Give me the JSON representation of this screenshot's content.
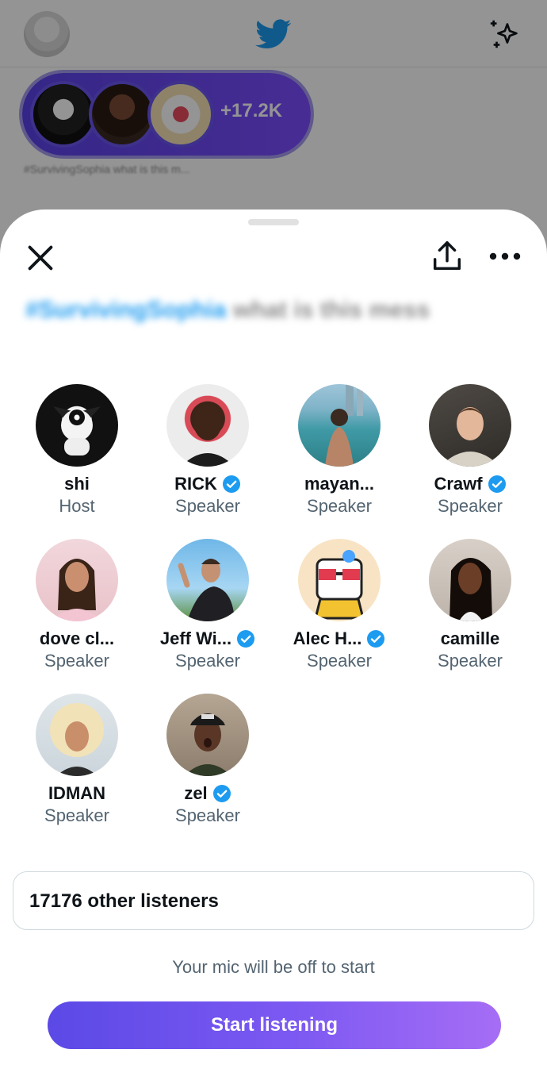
{
  "background": {
    "space_listener_count": "+17.2K",
    "space_snippet": "#SurvivingSophia what is this m..."
  },
  "sheet": {
    "title_hashtag": "#SurvivingSophia",
    "title_rest": "what is this mess"
  },
  "participants": [
    {
      "name": "shi",
      "role": "Host",
      "verified": false
    },
    {
      "name": "RICK",
      "role": "Speaker",
      "verified": true
    },
    {
      "name": "mayan...",
      "role": "Speaker",
      "verified": false
    },
    {
      "name": "Crawf",
      "role": "Speaker",
      "verified": true
    },
    {
      "name": "dove cl...",
      "role": "Speaker",
      "verified": false
    },
    {
      "name": "Jeff Wi...",
      "role": "Speaker",
      "verified": true
    },
    {
      "name": "Alec H...",
      "role": "Speaker",
      "verified": true
    },
    {
      "name": "camille",
      "role": "Speaker",
      "verified": false
    },
    {
      "name": "IDMAN",
      "role": "Speaker",
      "verified": false
    },
    {
      "name": "zel",
      "role": "Speaker",
      "verified": true
    }
  ],
  "listeners_label": "17176 other listeners",
  "mic_note": "Your mic will be off to start",
  "start_button_label": "Start listening",
  "colors": {
    "accent_blue": "#1d9bf0",
    "button_gradient_start": "#5b49e6",
    "button_gradient_end": "#a66df5"
  }
}
